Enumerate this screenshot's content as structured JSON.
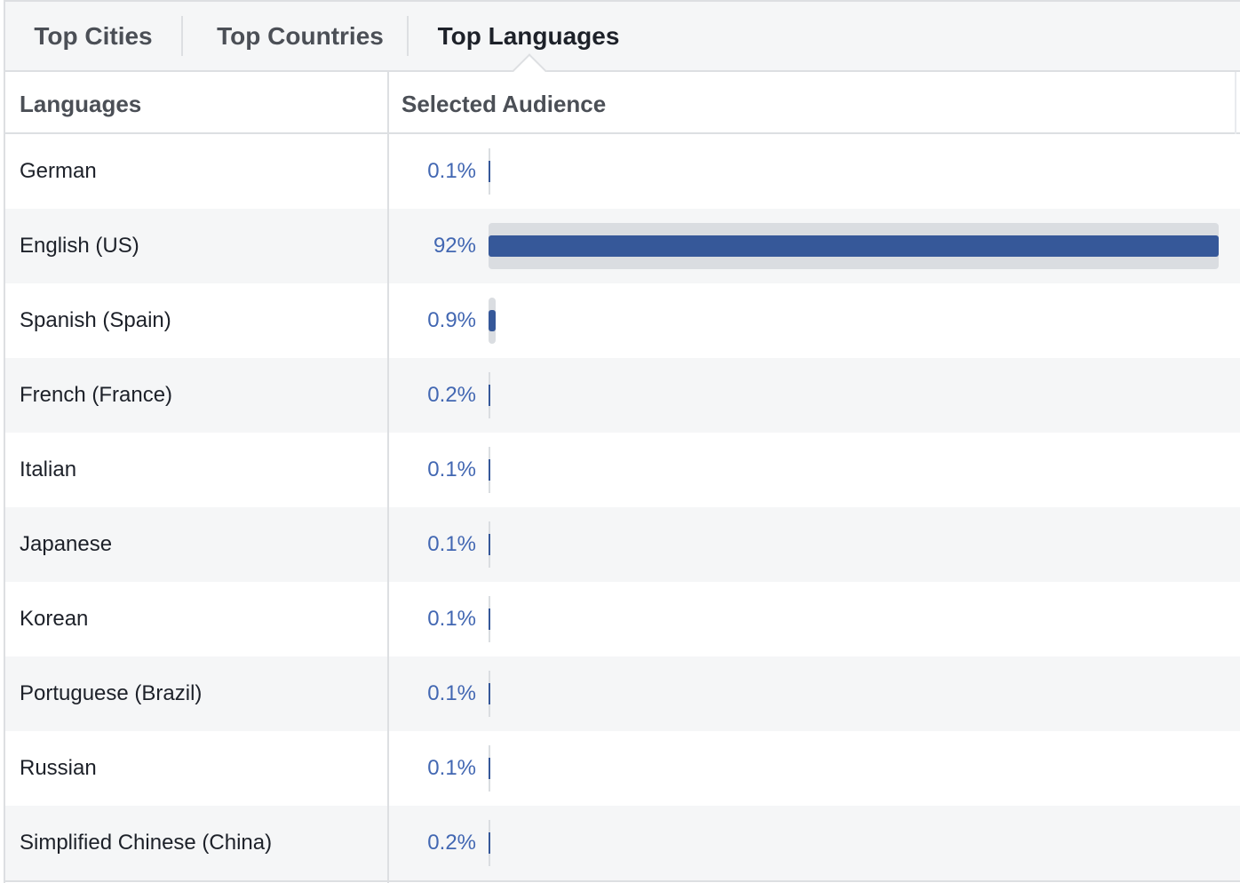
{
  "tabs": [
    {
      "label": "Top Cities",
      "active": false
    },
    {
      "label": "Top Countries",
      "active": false
    },
    {
      "label": "Top Languages",
      "active": true
    }
  ],
  "table": {
    "headers": {
      "language": "Languages",
      "audience": "Selected Audience"
    },
    "max_value": 92,
    "rows": [
      {
        "language": "German",
        "percent_label": "0.1%",
        "value": 0.1
      },
      {
        "language": "English (US)",
        "percent_label": "92%",
        "value": 92
      },
      {
        "language": "Spanish (Spain)",
        "percent_label": "0.9%",
        "value": 0.9
      },
      {
        "language": "French (France)",
        "percent_label": "0.2%",
        "value": 0.2
      },
      {
        "language": "Italian",
        "percent_label": "0.1%",
        "value": 0.1
      },
      {
        "language": "Japanese",
        "percent_label": "0.1%",
        "value": 0.1
      },
      {
        "language": "Korean",
        "percent_label": "0.1%",
        "value": 0.1
      },
      {
        "language": "Portuguese (Brazil)",
        "percent_label": "0.1%",
        "value": 0.1
      },
      {
        "language": "Russian",
        "percent_label": "0.1%",
        "value": 0.1
      },
      {
        "language": "Simplified Chinese (China)",
        "percent_label": "0.2%",
        "value": 0.2
      }
    ]
  },
  "colors": {
    "bar_fill": "#365899",
    "bar_track": "#dadde1",
    "percent_text": "#4267b2",
    "alt_row": "#f5f6f7"
  }
}
